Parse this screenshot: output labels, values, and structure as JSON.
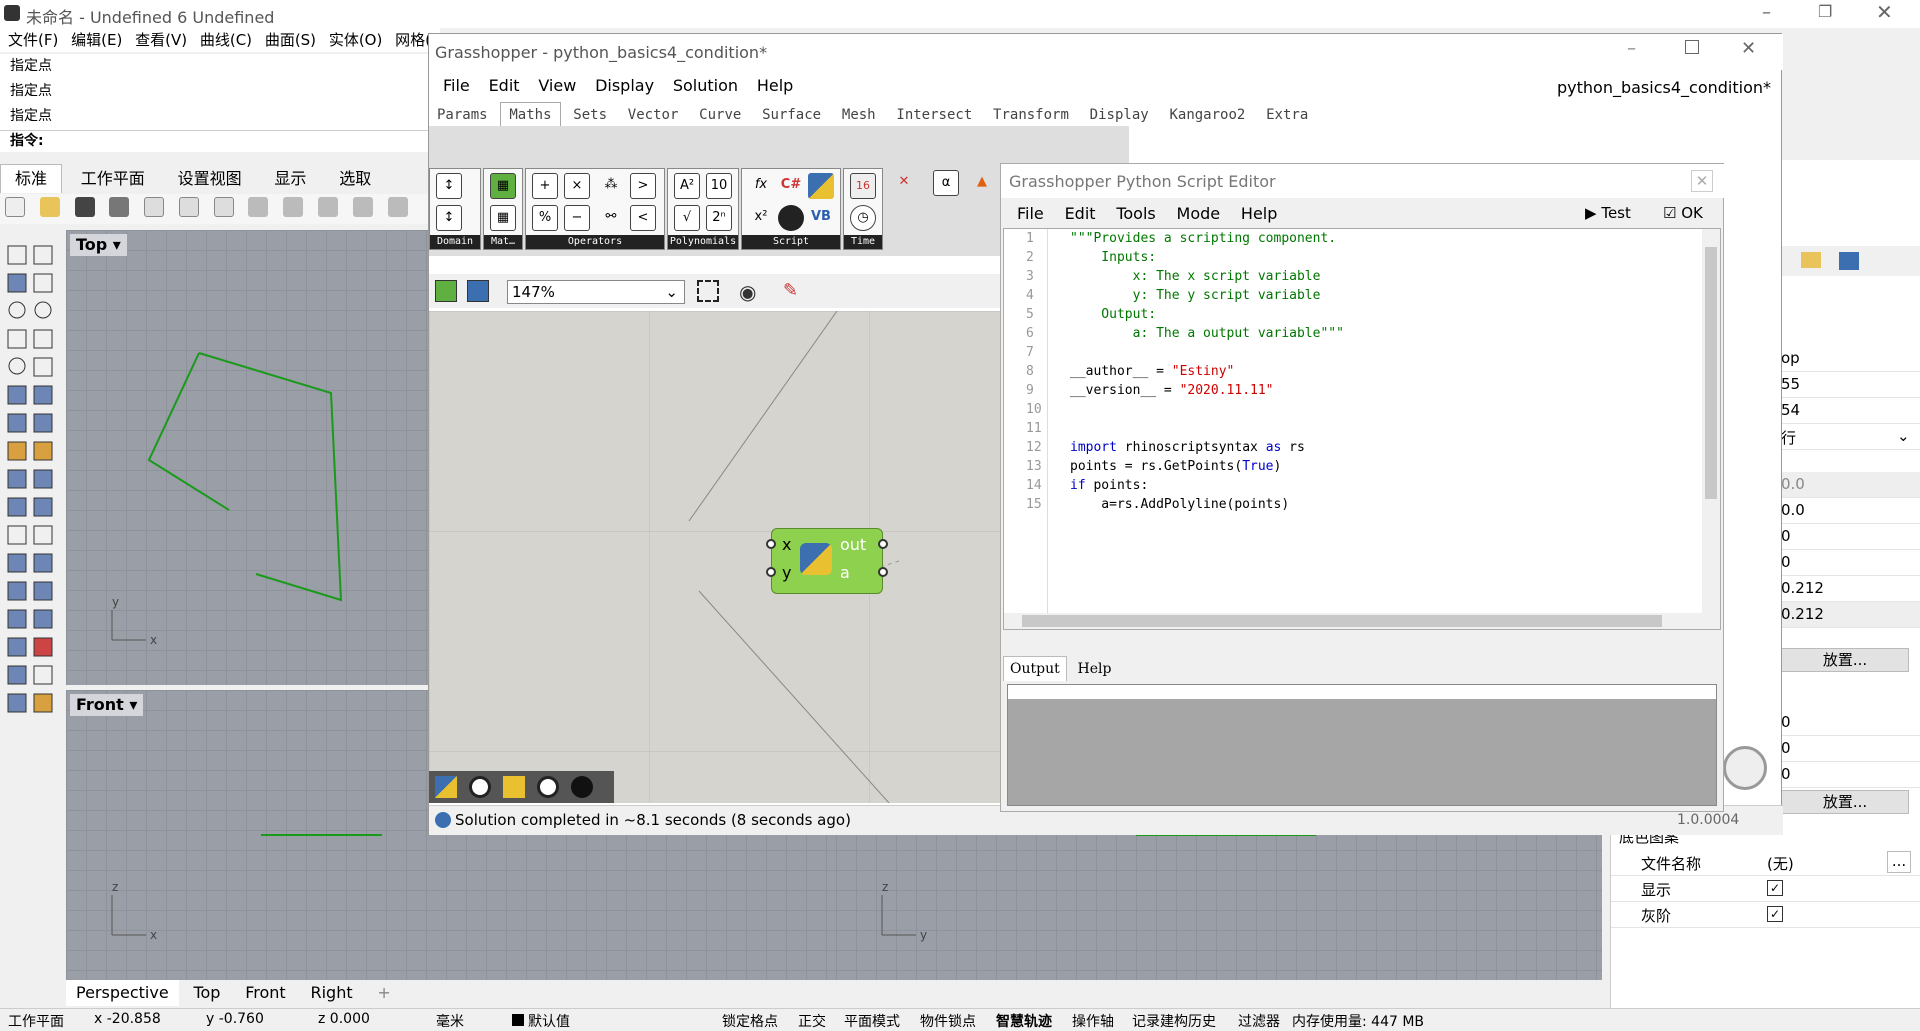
{
  "rhino": {
    "title": "未命名 - Undefined 6 Undefined",
    "menu": [
      "文件(F)",
      "编辑(E)",
      "查看(V)",
      "曲线(C)",
      "曲面(S)",
      "实体(O)",
      "网格("
    ],
    "history": [
      "指定点",
      "指定点",
      "指定点"
    ],
    "command_prompt": "指令:",
    "tabs": [
      "标准",
      "工作平面",
      "设置视图",
      "显示",
      "选取"
    ],
    "viewport_top_label": "Top",
    "viewport_front_label": "Front",
    "viewport_tabs": [
      "Perspective",
      "Top",
      "Front",
      "Right"
    ],
    "add_tab": "+",
    "status": {
      "cplane": "工作平面",
      "x": "x -20.858",
      "y": "y -0.760",
      "z": "z 0.000",
      "unit": "毫米",
      "layer": "默认值",
      "toggles": [
        "锁定格点",
        "正交",
        "平面模式",
        "物件锁点",
        "智慧轨迹",
        "操作轴",
        "记录建构历史",
        "过滤器"
      ],
      "memory": "内存使用量: 447 MB"
    },
    "panel": {
      "values": [
        "op",
        "55",
        "54",
        "行",
        "0.0",
        "0.0",
        "0",
        "0",
        "0.212",
        "0.212"
      ],
      "place_btn": "放置...",
      "values2": [
        "0",
        "0",
        "0"
      ],
      "place_btn2": "放置...",
      "section": "底色图案",
      "file_label": "文件名称",
      "file_value": "(无)",
      "browse": "...",
      "show_label": "显示",
      "gray_label": "灰阶"
    }
  },
  "gh": {
    "title": "Grasshopper - python_basics4_condition*",
    "doc_name": "python_basics4_condition*",
    "menu": [
      "File",
      "Edit",
      "View",
      "Display",
      "Solution",
      "Help"
    ],
    "tabs": [
      "Params",
      "Maths",
      "Sets",
      "Vector",
      "Curve",
      "Surface",
      "Mesh",
      "Intersect",
      "Transform",
      "Display",
      "Kangaroo2",
      "Extra"
    ],
    "active_tab": "Maths",
    "groups": [
      "Domain",
      "Mat…",
      "Operators",
      "Polynomials",
      "Script",
      "Time"
    ],
    "zoom": "147%",
    "component": {
      "in1": "x",
      "in2": "y",
      "out1": "out",
      "out2": "a"
    },
    "status": "Solution completed in ~8.1 seconds (8 seconds ago)",
    "version": "1.0.0004"
  },
  "editor": {
    "title": "Grasshopper Python Script Editor",
    "menu": [
      "File",
      "Edit",
      "Tools",
      "Mode",
      "Help"
    ],
    "test": "Test",
    "ok": "OK",
    "output_tab": "Output",
    "help_tab": "Help",
    "code": [
      "\"\"\"Provides a scripting component.",
      "    Inputs:",
      "        x: The x script variable",
      "        y: The y script variable",
      "    Output:",
      "        a: The a output variable\"\"\"",
      "",
      "__author__ = \"Estiny\"",
      "__version__ = \"2020.11.11\"",
      "",
      "",
      "import rhinoscriptsyntax as rs",
      "points = rs.GetPoints(True)",
      "if points:",
      "    a=rs.AddPolyline(points)"
    ]
  },
  "colors": {
    "curve": "#1a9a1a",
    "component": "#8ed14e"
  }
}
